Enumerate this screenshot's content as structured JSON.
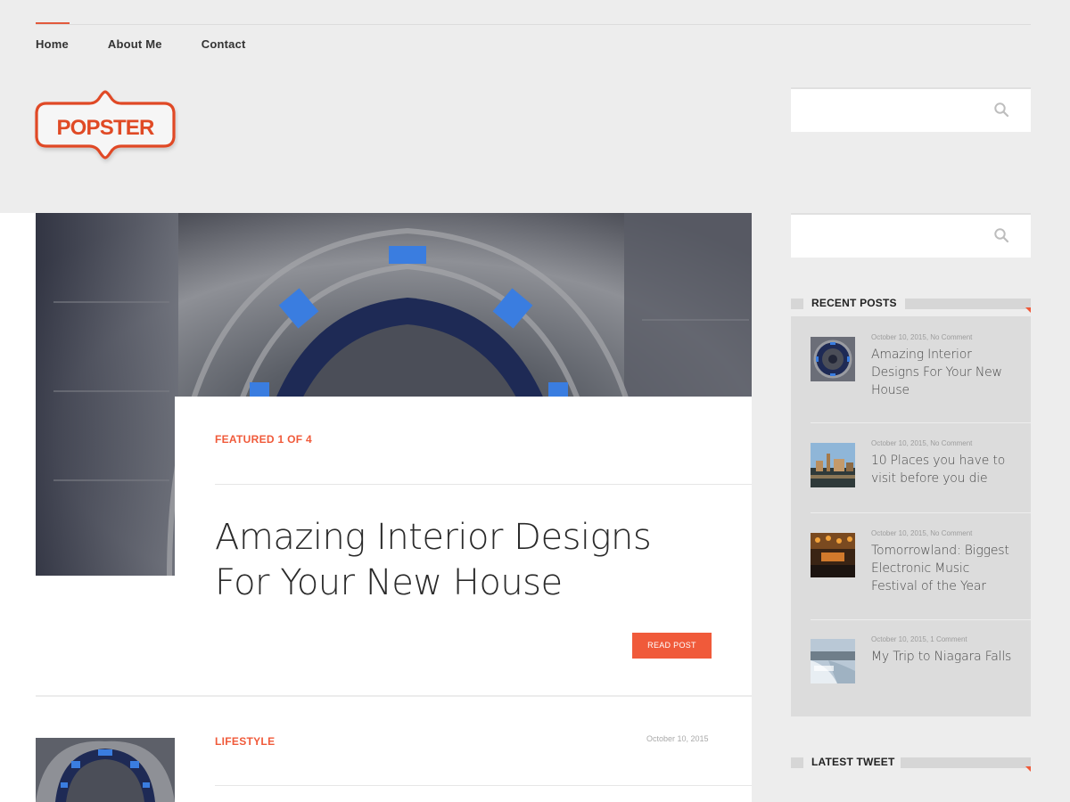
{
  "nav": {
    "items": [
      "Home",
      "About Me",
      "Contact"
    ]
  },
  "logo": {
    "text": "POPSTER"
  },
  "colors": {
    "accent": "#f05a3a",
    "logo": "#e04a25",
    "background": "#ededed"
  },
  "icons": {
    "search": "search-icon"
  },
  "hero": {
    "label": "FEATURED 1 OF 4",
    "title": "Amazing Interior Designs For Your New House",
    "button": "READ POST"
  },
  "post2": {
    "category": "LIFESTYLE",
    "date": "October 10, 2015"
  },
  "sidebar": {
    "recent_title": "RECENT POSTS",
    "latest_tweet_title": "LATEST TWEET",
    "recent_posts": [
      {
        "meta": "October 10, 2015, No Comment",
        "title": "Amazing Interior Designs For Your New House"
      },
      {
        "meta": "October 10, 2015, No Comment",
        "title": "10 Places you have to visit before you die"
      },
      {
        "meta": "October 10, 2015, No Comment",
        "title": "Tomorrowland: Biggest Electronic Music Festival of the Year"
      },
      {
        "meta": "October 10, 2015, 1 Comment",
        "title": "My Trip to Niagara Falls"
      }
    ]
  }
}
